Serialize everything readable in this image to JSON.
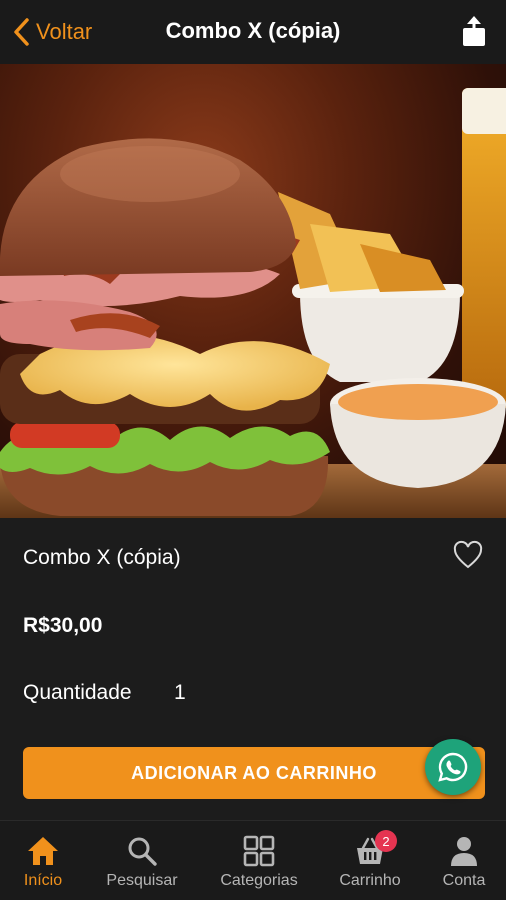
{
  "header": {
    "back_label": "Voltar",
    "title": "Combo X (cópia)"
  },
  "product": {
    "name": "Combo X (cópia)",
    "price": "R$30,00",
    "quantity_label": "Quantidade",
    "quantity_value": "1",
    "add_button_label": "ADICIONAR AO CARRINHO"
  },
  "nav": {
    "items": [
      {
        "label": "Início",
        "icon": "home-icon",
        "active": true
      },
      {
        "label": "Pesquisar",
        "icon": "search-icon"
      },
      {
        "label": "Categorias",
        "icon": "grid-icon"
      },
      {
        "label": "Carrinho",
        "icon": "basket-icon",
        "badge": "2"
      },
      {
        "label": "Conta",
        "icon": "user-icon"
      }
    ]
  },
  "colors": {
    "accent": "#f0911c",
    "background": "#1c1c1c",
    "whatsapp": "#1ea37a",
    "badge": "#e53451"
  }
}
